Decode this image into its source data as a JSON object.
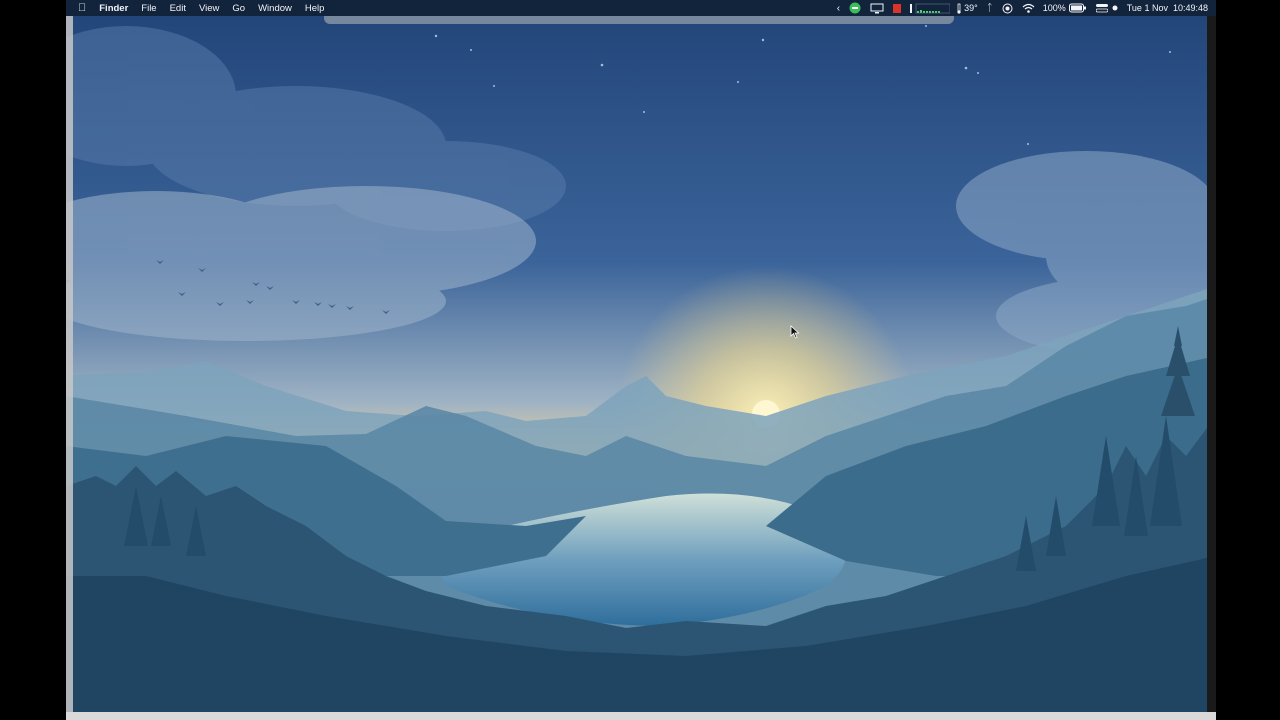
{
  "menubar": {
    "apple_icon": "apple-icon",
    "app_name": "Finder",
    "items": [
      "File",
      "Edit",
      "View",
      "Go",
      "Window",
      "Help"
    ],
    "status": {
      "temperature": "39°",
      "battery": "100%",
      "datetime": "Tue 1 Nov  10:49:48"
    },
    "icons": [
      "chevron-left-icon",
      "green-app-icon",
      "display-icon",
      "red-app-icon",
      "activity-meter-icon",
      "thermometer-icon",
      "bluetooth-icon",
      "screen-record-icon",
      "wifi-icon",
      "battery-icon",
      "control-center-icon",
      "siri-icon"
    ]
  },
  "desktop": {
    "wallpaper": "mountain-lake-sunrise"
  }
}
